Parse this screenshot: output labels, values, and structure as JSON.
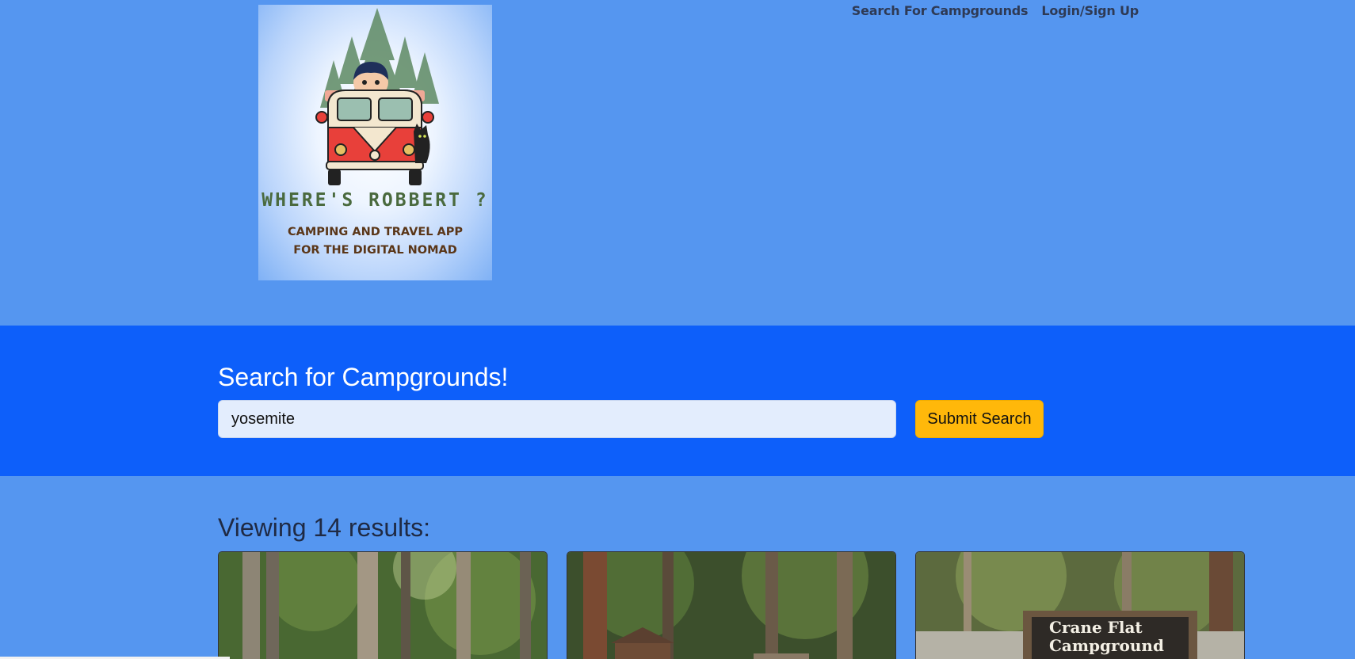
{
  "nav": {
    "search_link": "Search For Campgrounds",
    "login_link": "Login/Sign Up"
  },
  "logo": {
    "title": "WHERE'S ROBBERT ?",
    "subtitle_line1": "CAMPING AND TRAVEL APP",
    "subtitle_line2": "FOR THE DIGITAL NOMAD"
  },
  "search": {
    "heading": "Search for Campgrounds!",
    "input_value": "yosemite",
    "submit_label": "Submit Search"
  },
  "results": {
    "heading": "Viewing 14 results:",
    "cards": [
      {
        "image": "forest-campground-photo"
      },
      {
        "image": "campground-cabin-photo"
      },
      {
        "image": "crane-flat-sign-photo",
        "sign_line1": "Crane Flat",
        "sign_line2": "Campground"
      }
    ]
  },
  "colors": {
    "page_bg": "#5596f0",
    "search_band": "#0d5ffa",
    "button": "#ffb80a"
  }
}
